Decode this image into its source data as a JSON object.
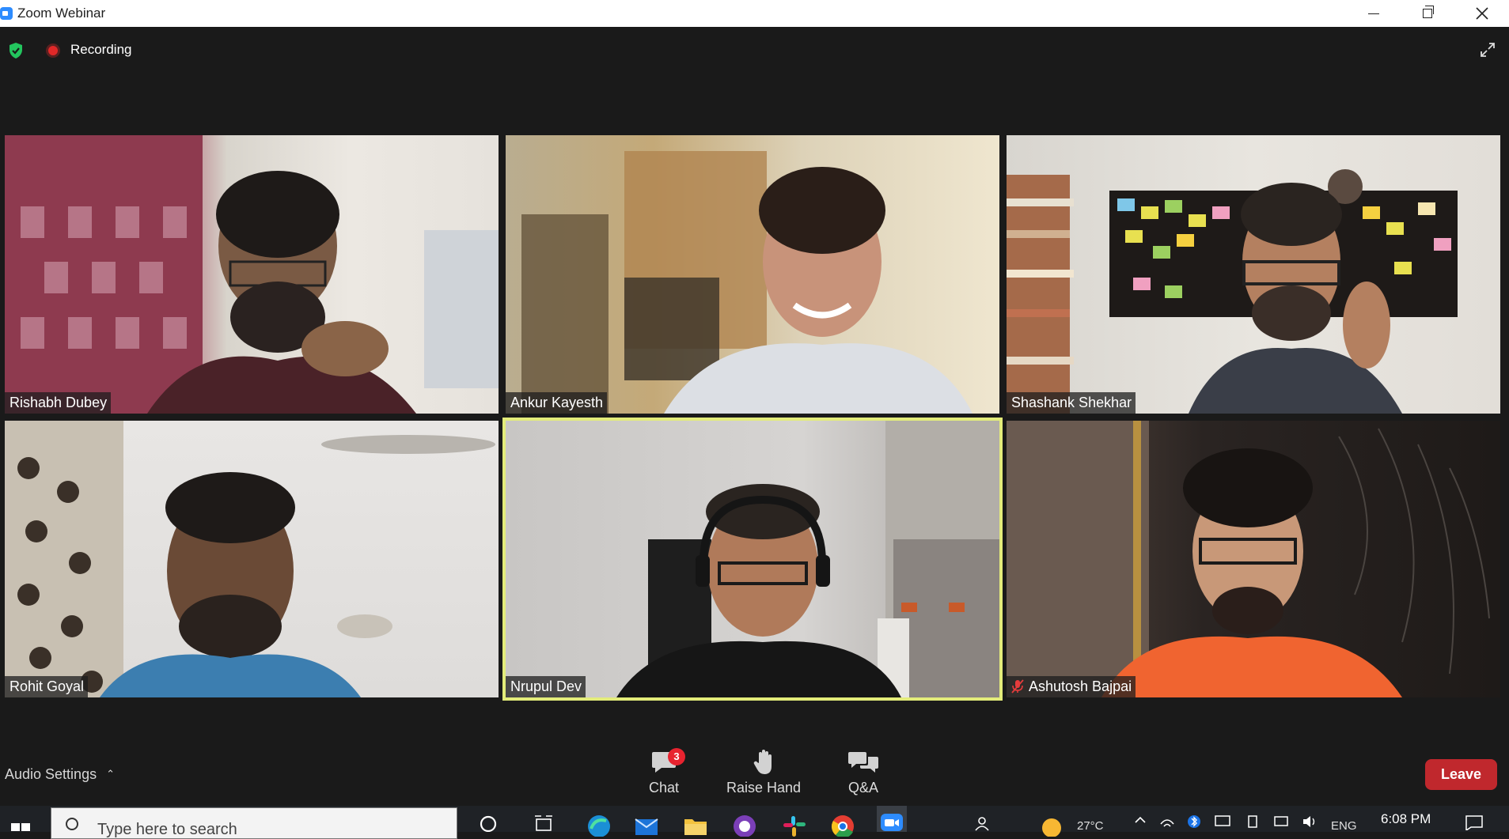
{
  "window": {
    "title": "Zoom Webinar"
  },
  "top_bar": {
    "recording_label": "Recording"
  },
  "participants": [
    {
      "name": "Rishabh Dubey",
      "muted": false
    },
    {
      "name": "Ankur Kayesth",
      "muted": false
    },
    {
      "name": "Shashank Shekhar",
      "muted": false
    },
    {
      "name": "Rohit Goyal",
      "muted": false
    },
    {
      "name": "Nrupul Dev",
      "muted": false,
      "active_speaker": true
    },
    {
      "name": "Ashutosh Bajpai",
      "muted": true
    }
  ],
  "toolbar": {
    "audio_settings_label": "Audio Settings",
    "chat_label": "Chat",
    "chat_badge": "3",
    "raise_hand_label": "Raise Hand",
    "qa_label": "Q&A",
    "leave_label": "Leave"
  },
  "taskbar": {
    "search_placeholder": "Type here to search",
    "weather": "27°C",
    "language": "ENG",
    "time": "6:08 PM"
  },
  "colors": {
    "active_speaker_border": "#e3ec7a",
    "leave_button": "#c0282d",
    "badge": "#e8232f",
    "zoom_blue": "#2d8cff"
  }
}
